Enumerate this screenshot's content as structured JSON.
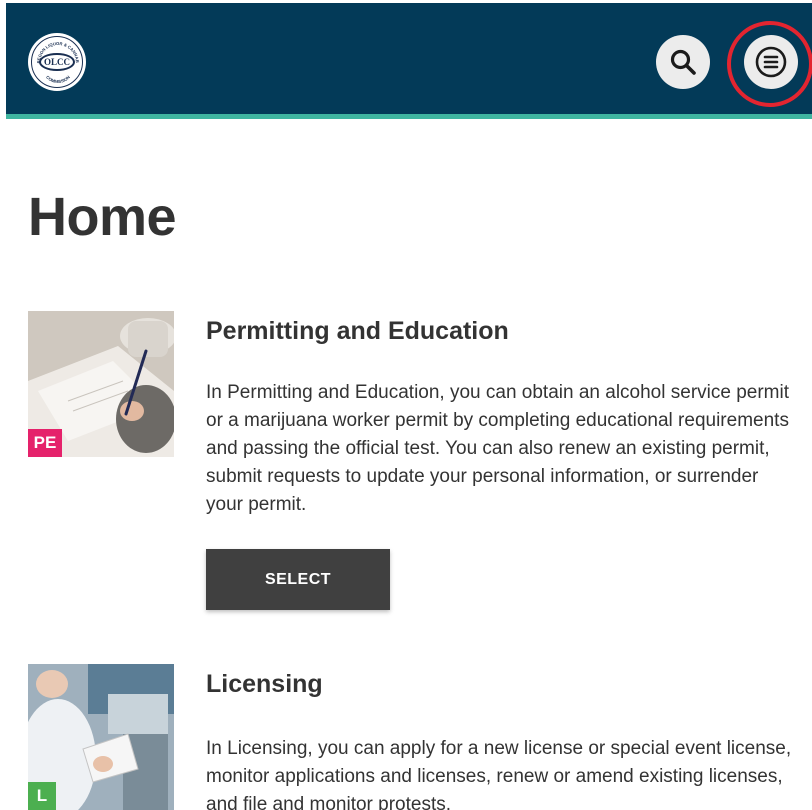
{
  "header": {
    "logo_text": "OLCC",
    "logo_ring_top": "OREGON LIQUOR & CANNABIS",
    "logo_ring_bottom": "COMMISSION",
    "search_icon": "search-icon",
    "menu_icon": "hamburger-menu-icon"
  },
  "page": {
    "title": "Home"
  },
  "cards": [
    {
      "tag": "PE",
      "title": "Permitting and Education",
      "description": "In Permitting and Education, you can obtain an alcohol service permit or a marijuana worker permit by completing educational requirements and passing the official test. You can also renew an existing permit, submit requests to update your personal information, or surrender your permit.",
      "button_label": "SELECT",
      "tag_color": "#e5226b"
    },
    {
      "tag": "L",
      "title": "Licensing",
      "description": "In Licensing, you can apply for a new license or special event license, monitor applications and licenses, renew or amend existing licenses, and file and monitor protests.",
      "tag_color": "#4caf50"
    }
  ],
  "colors": {
    "header_bg": "#033a58",
    "header_accent": "#3fb5a0",
    "button_bg": "#404040",
    "highlight": "#e32530"
  }
}
